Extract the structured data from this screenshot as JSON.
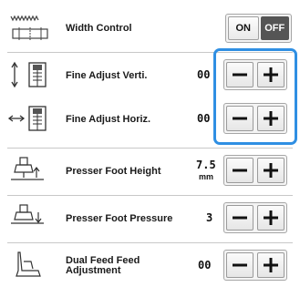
{
  "rows": [
    {
      "label": "Width Control",
      "toggle": {
        "on": "ON",
        "off": "OFF",
        "state": "off"
      }
    },
    {
      "label": "Fine Adjust Verti.",
      "value": "00"
    },
    {
      "label": "Fine Adjust Horiz.",
      "value": "00"
    },
    {
      "label": "Presser Foot Height",
      "value": "7.5",
      "unit": "mm"
    },
    {
      "label": "Presser Foot Pressure",
      "value": "3"
    },
    {
      "label_line1": "Dual Feed Feed",
      "label_line2": "Adjustment",
      "value": "00"
    }
  ],
  "colors": {
    "highlight": "#2f8fe3",
    "toggle_active": "#555555"
  },
  "icons": [
    "width-control-icon",
    "vertical-adjust-icon",
    "horizontal-adjust-icon",
    "presser-foot-height-icon",
    "presser-foot-pressure-icon",
    "dual-feed-foot-icon"
  ]
}
